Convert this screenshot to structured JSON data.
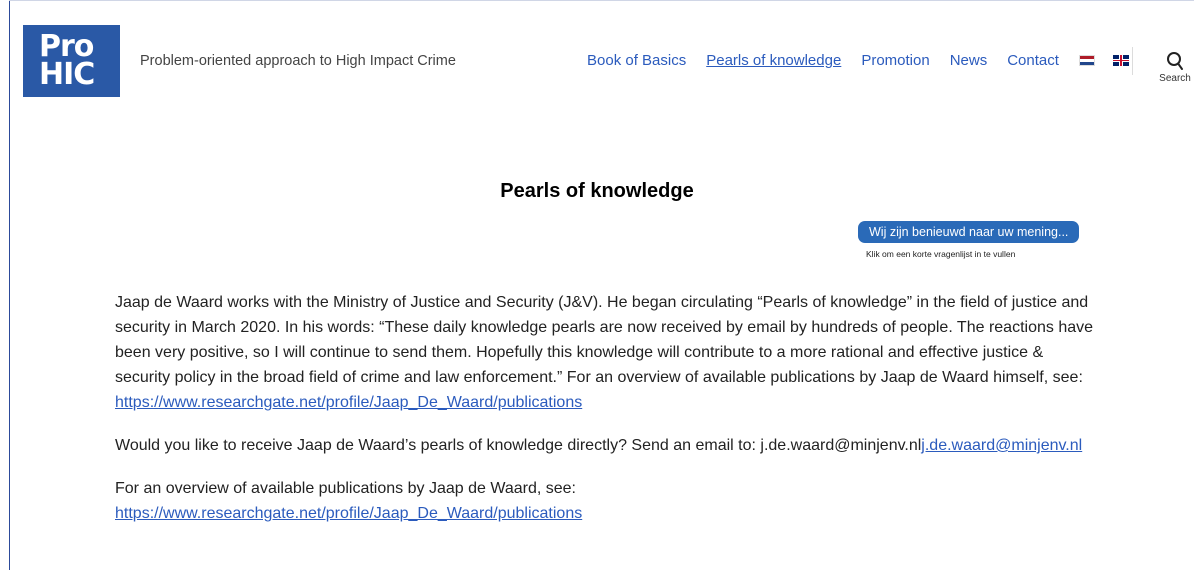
{
  "brand": {
    "logo_line1": "Pro",
    "logo_line2": "HIC",
    "tagline": "Problem-oriented approach to High Impact Crime"
  },
  "nav": {
    "items": [
      {
        "label": "Book of Basics"
      },
      {
        "label": "Pearls of knowledge",
        "current": true
      },
      {
        "label": "Promotion"
      },
      {
        "label": "News"
      },
      {
        "label": "Contact"
      }
    ],
    "flags": [
      "nl-flag-icon",
      "uk-flag-icon"
    ],
    "search_label": "Search"
  },
  "page": {
    "title": "Pearls of knowledge"
  },
  "survey": {
    "button_label": "Wij zijn benieuwd naar uw mening...",
    "subtext": "Klik om een korte vragenlijst in te vullen"
  },
  "content": {
    "p1_text": "Jaap de Waard works with the Ministry of Justice and Security (J&V). He began circulating “Pearls of knowledge” in the field of justice and security in March 2020. In his words: “These daily knowledge pearls are now received by email by hundreds of people. The reactions have been very positive, so I will continue to send them. Hopefully this knowledge will contribute to a more rational and effective justice & security policy in the broad field of crime and law enforcement.” For an overview of available publications by Jaap de Waard himself, see: ",
    "p1_link": "https://www.researchgate.net/profile/Jaap_De_Waard/publications",
    "p2_text": "Would you like to receive Jaap de Waard’s pearls of knowledge directly? Send an email to: j.de.waard@minjenv.nl",
    "p2_link": "j.de.waard@minjenv.nl",
    "p3_text": "For an overview of available publications by Jaap de Waard, see: ",
    "p3_link": "https://www.researchgate.net/profile/Jaap_De_Waard/publications"
  },
  "colors": {
    "brand_blue": "#2a59a6",
    "link": "#2b5bbd",
    "survey_button": "#2a6ab8"
  }
}
